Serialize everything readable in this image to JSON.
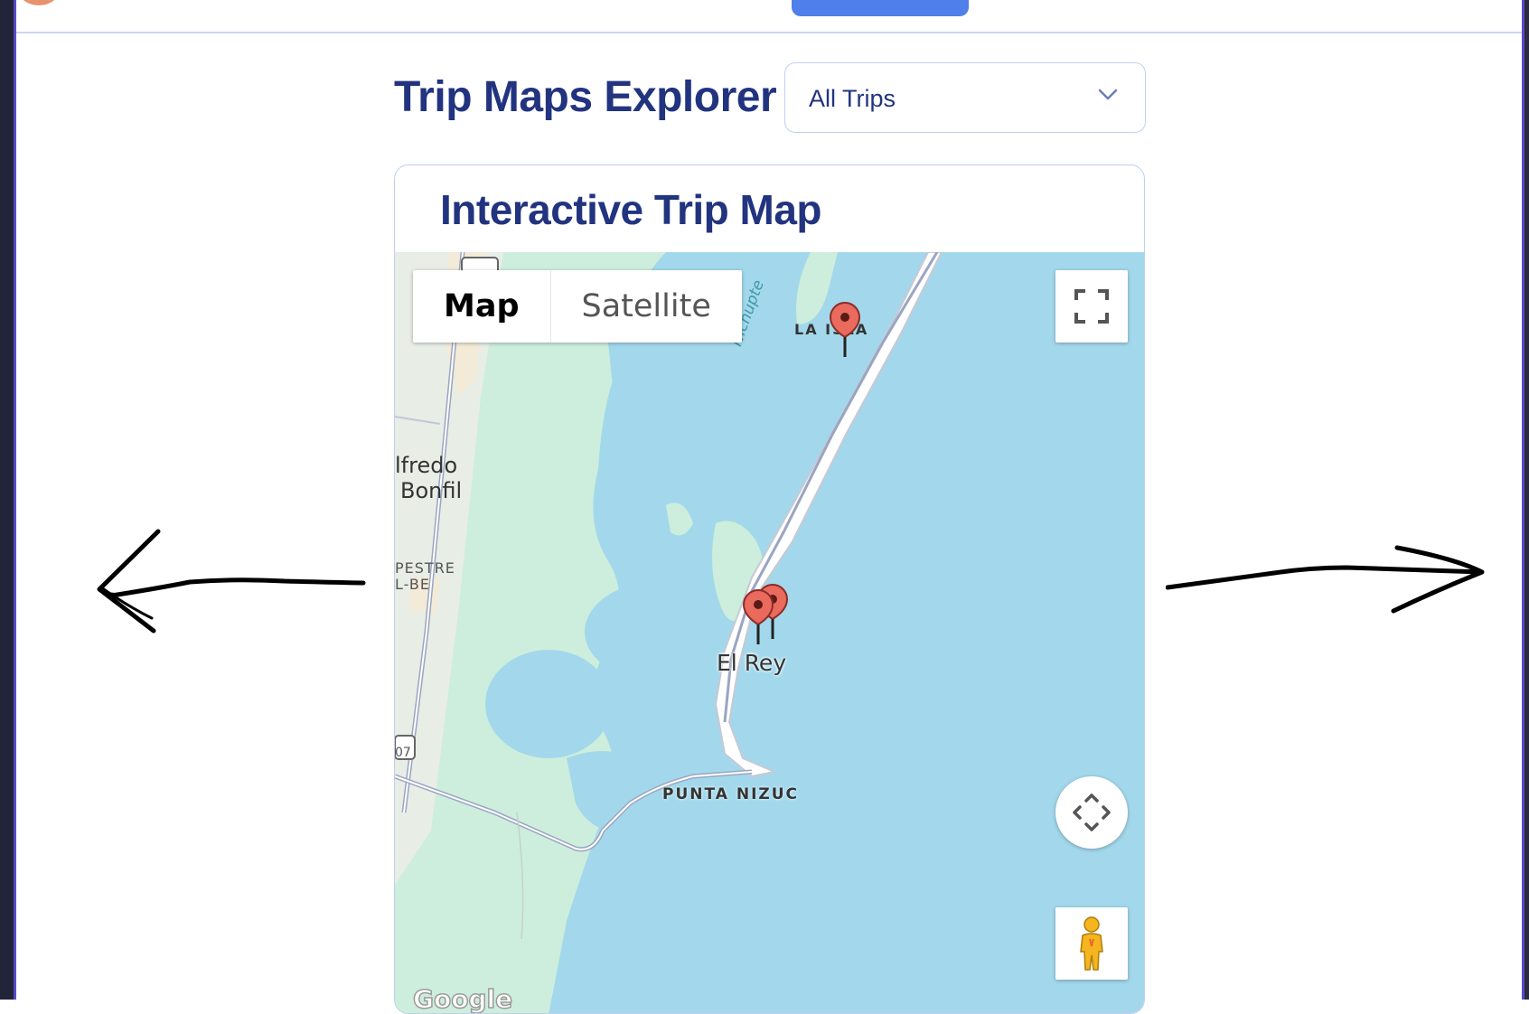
{
  "header": {
    "page_title": "Trip Maps Explorer",
    "trip_filter": {
      "selected": "All Trips"
    }
  },
  "map_card": {
    "title": "Interactive Trip Map",
    "map_type_controls": {
      "map": "Map",
      "satellite": "Satellite",
      "selected": "Map"
    },
    "labels": {
      "bonfil_1": "lfredo",
      "bonfil_2": "Bonfil",
      "estre": "PESTRE",
      "lbe": "L-BE",
      "la_isla": "LA ISLA",
      "nichupte": "Nichupte",
      "el_rey": "El Rey",
      "punta_nizuc": "PUNTA NIZUC",
      "route": "07",
      "attribution": "Google"
    },
    "markers": 3
  },
  "colors": {
    "title": "#22347f",
    "water": "#a3d8ec",
    "land": "#cdeedc",
    "marker": "#ea6a5e",
    "accent_button": "#4f7fe8"
  },
  "icons": [
    "chevron-down-icon",
    "fullscreen-icon",
    "pan-control-icon",
    "pegman-icon",
    "map-pin-icon",
    "left-arrow-icon",
    "right-arrow-icon"
  ]
}
